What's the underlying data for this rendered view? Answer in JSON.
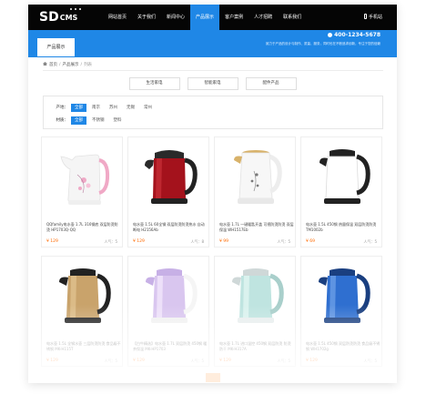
{
  "header": {
    "logo": "SD",
    "logo_suffix": "CMS",
    "nav": [
      "网站首页",
      "关于我们",
      "新闻中心",
      "产品展示",
      "客户案例",
      "人才招聘",
      "联系我们"
    ],
    "active_nav": "产品展示",
    "mobile": "手机站"
  },
  "banner": {
    "tab": "产品展示",
    "hotline": "400-1234-5678",
    "hotline_note": "致力于产品的设计与制作、质量、服务，同时也在不断追求创新，专注于您的信赖"
  },
  "breadcrumb": {
    "home": "首页",
    "section": "产品展示",
    "current": "列表"
  },
  "categories": [
    "生活家电",
    "智能家电",
    "配件产品"
  ],
  "filters": {
    "origin": {
      "label": "产地：",
      "options": [
        "全部",
        "南京",
        "苏州",
        "无锡",
        "常州"
      ],
      "selected": "全部"
    },
    "material": {
      "label": "材质：",
      "options": [
        "全部",
        "不锈钢",
        "塑料"
      ],
      "selected": "全部"
    }
  },
  "products": [
    {
      "name": "QQfamily电水壶 1.7L 316钢底 双层防烫防烫 HP1703Q-QQ",
      "price": "¥ 129",
      "views": "人气：5",
      "color": "#f2f2f2",
      "accent": "#f0a9c6"
    },
    {
      "name": "电水壶 1.5L 60全钢 双层防烫防烫热水 自动断电 H2156Ab",
      "price": "¥ 129",
      "views": "人气：8",
      "color": "#a4121c",
      "accent": "#222222"
    },
    {
      "name": "电水壶 1.7L 一键暖匙开盖 可视防烫防烫 双层保温 WH1517Eb",
      "price": "¥ 99",
      "views": "人气：5",
      "color": "#f4f4f4",
      "accent": "#d8b26a"
    },
    {
      "name": "电水壶 1.5L 450钢 热量保温 双层防烫防烫 TM1002b",
      "price": "¥ 69",
      "views": "人气：5",
      "color": "#ffffff",
      "accent": "#222222"
    },
    {
      "name": "电水壶 1.5L 全钢水壶 三层防烫防烫 食品级不锈钢 MK-H115T",
      "price": "¥ 129",
      "views": "人气：5",
      "color": "#c9a36b",
      "accent": "#222222"
    },
    {
      "name": "【白牛精选】电水壶 1.7L 双层防烫 450钢 暖茶保温 MK-HP1703",
      "price": "¥ 129",
      "views": "人气：5",
      "color": "#d9c6ef",
      "accent": "#ffffff"
    },
    {
      "name": "电水壶 1.7L 进口温控 450钢 双层防烫 防烫防干 MK-H317A",
      "price": "¥ 129",
      "views": "人气：5",
      "color": "#bfe4e0",
      "accent": "#cfd8d8"
    },
    {
      "name": "电水壶 1.5L 450钢 双层防烫防烫 食品级不锈钢 WH1702g",
      "price": "¥ 129",
      "views": "人气：5",
      "color": "#2f6fd0",
      "accent": "#1a3f80"
    }
  ]
}
